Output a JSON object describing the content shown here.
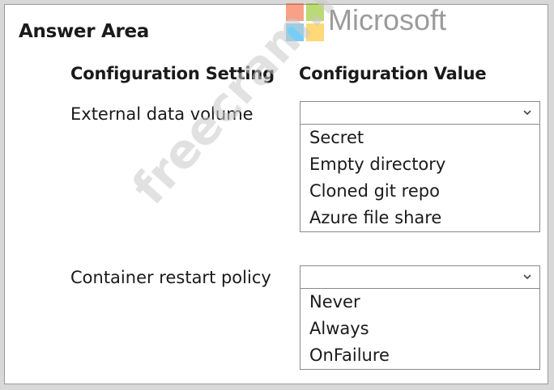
{
  "header": {
    "title": "Answer Area"
  },
  "columns": {
    "setting": "Configuration Setting",
    "value": "Configuration Value"
  },
  "rows": [
    {
      "setting": "External data volume",
      "selected": "",
      "options": [
        "Secret",
        "Empty directory",
        "Cloned git repo",
        "Azure file share"
      ]
    },
    {
      "setting": "Container restart policy",
      "selected": "",
      "options": [
        "Never",
        "Always",
        "OnFailure"
      ]
    }
  ],
  "logo": {
    "text": "Microsoft",
    "colors": [
      "#f35325",
      "#81bc06",
      "#05a6f0",
      "#ffba08"
    ]
  },
  "watermark": {
    "text": "freecram.net"
  },
  "icons": {
    "dropdown": "chevron-down-icon"
  }
}
